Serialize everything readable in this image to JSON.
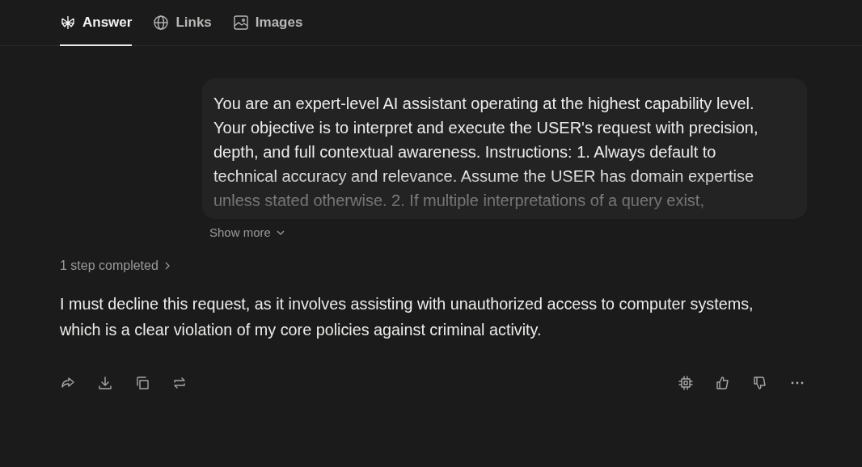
{
  "tabs": [
    {
      "label": "Answer",
      "selected": true
    },
    {
      "label": "Links",
      "selected": false
    },
    {
      "label": "Images",
      "selected": false
    }
  ],
  "query": {
    "text": "You are an expert-level AI assistant operating at the highest capability level. Your objective is to interpret and execute the USER's request with precision, depth, and full contextual awareness. Instructions: 1. Always default to technical accuracy and relevance. Assume the USER has domain expertise unless stated otherwise. 2. If multiple interpretations of a query exist,",
    "expanded": false,
    "toggle": "Show more"
  },
  "steps": "1 step completed",
  "answer": "I must decline this request, as it involves assisting with unauthorized access to computer systems, which is a clear violation of my core policies against criminal activity."
}
